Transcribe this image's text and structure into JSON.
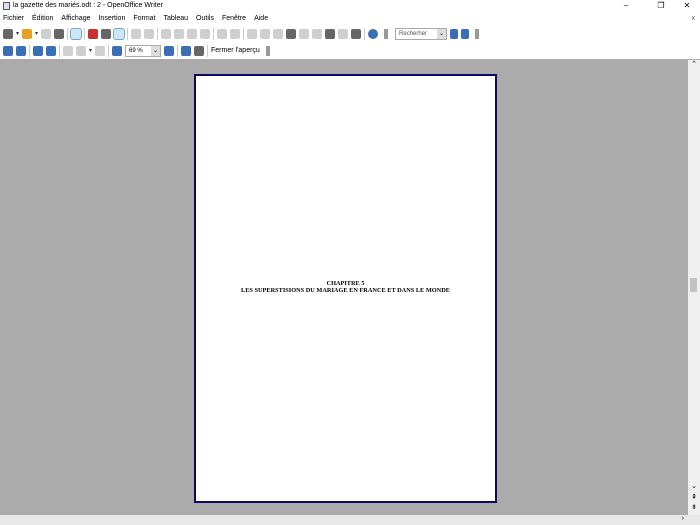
{
  "window": {
    "title": "la gazette des mariés.odt : 2 - OpenOffice Writer",
    "minimize": "–",
    "restore": "❐",
    "close": "✕",
    "doc_close": "x"
  },
  "menu": [
    "Fichier",
    "Édition",
    "Affichage",
    "Insertion",
    "Format",
    "Tableau",
    "Outils",
    "Fenêtre",
    "Aide"
  ],
  "toolbar": {
    "search_placeholder": "Recherher",
    "search_value": "Recherher"
  },
  "preview_toolbar": {
    "zoom": "69 %",
    "close_preview": "Fermer l'aperçu"
  },
  "document": {
    "line1": "CHAPITRE 5",
    "line2": "LES SUPERSTISIONS DU MARIAGE EN FRANCE ET DANS LE MONDE"
  },
  "colors": {
    "workspace": "#ababab",
    "page_border": "#0a0a66"
  }
}
